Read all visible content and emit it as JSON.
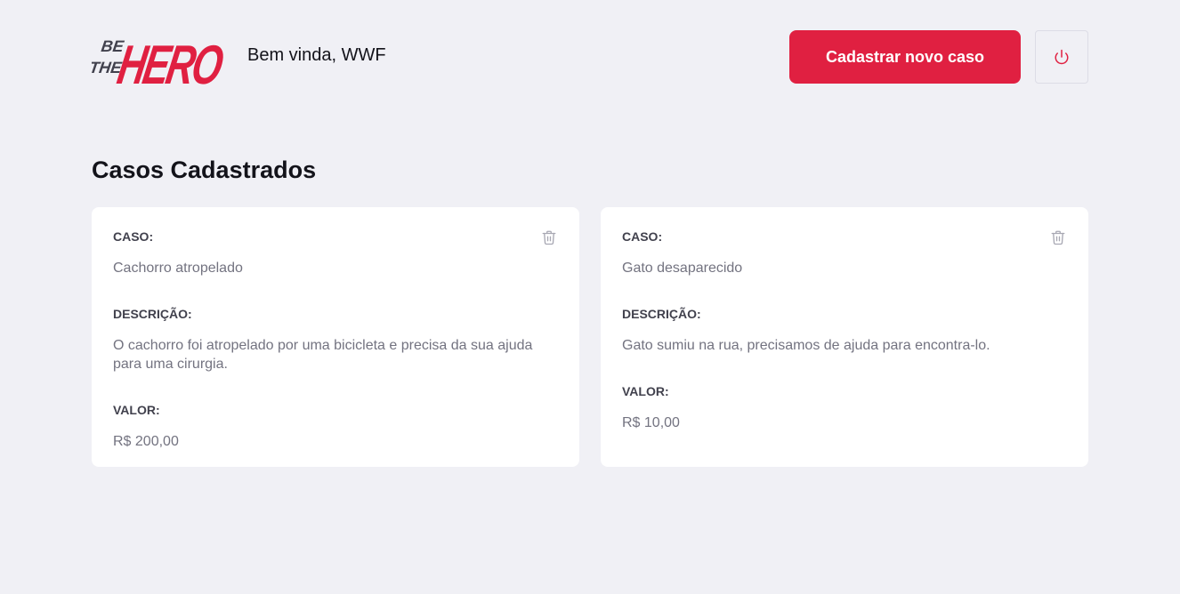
{
  "header": {
    "logo_alt": "Be The Hero",
    "logo_text_small_1": "BE",
    "logo_text_small_2": "THE",
    "logo_text_big": "HERO",
    "welcome": "Bem vinda, WWF",
    "new_case_button": "Cadastrar novo caso",
    "logout_icon": "power-icon"
  },
  "colors": {
    "accent": "#e02041",
    "background": "#f0f0f5"
  },
  "page_title": "Casos Cadastrados",
  "cases": [
    {
      "case_label": "CASO:",
      "case_value": "Cachorro atropelado",
      "description_label": "DESCRIÇÃO:",
      "description_value": "O cachorro foi atropelado por uma bicicleta e precisa da sua ajuda para uma cirurgia.",
      "value_label": "VALOR:",
      "value_value": "R$ 200,00",
      "delete_icon": "trash-icon"
    },
    {
      "case_label": "CASO:",
      "case_value": "Gato desaparecido",
      "description_label": "DESCRIÇÃO:",
      "description_value": "Gato sumiu na rua, precisamos de ajuda para encontra-lo.",
      "value_label": "VALOR:",
      "value_value": "R$ 10,00",
      "delete_icon": "trash-icon"
    }
  ]
}
